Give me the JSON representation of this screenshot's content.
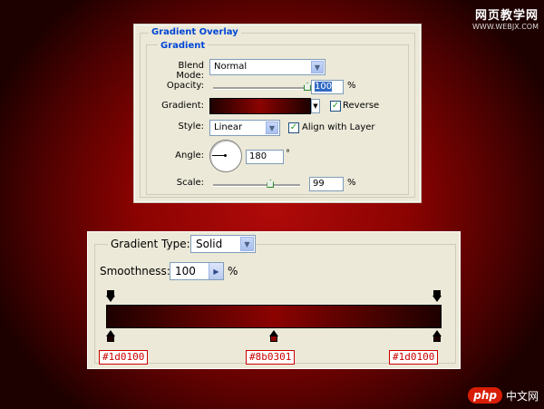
{
  "watermark_top": {
    "cn": "网页教学网",
    "url": "WWW.WEBJX.COM"
  },
  "watermark_bottom": {
    "logo": "php",
    "cn": "中文网"
  },
  "gradient_overlay": {
    "title": "Gradient Overlay",
    "section": "Gradient",
    "blend_mode_label": "Blend Mode:",
    "blend_mode_value": "Normal",
    "opacity_label": "Opacity:",
    "opacity_value": "100",
    "opacity_unit": "%",
    "gradient_label": "Gradient:",
    "reverse_label": "Reverse",
    "reverse_checked": true,
    "style_label": "Style:",
    "style_value": "Linear",
    "align_label": "Align with Layer",
    "align_checked": true,
    "angle_label": "Angle:",
    "angle_value": "180",
    "angle_unit": "°",
    "scale_label": "Scale:",
    "scale_value": "99",
    "scale_unit": "%",
    "opacity_fraction": 1.0,
    "scale_fraction": 0.66
  },
  "gradient_editor": {
    "type_label": "Gradient Type:",
    "type_value": "Solid",
    "smoothness_label": "Smoothness:",
    "smoothness_value": "100",
    "smoothness_unit": "%",
    "color_stops": [
      {
        "hex": "#1d0100",
        "label": "#1d0100",
        "location": 0
      },
      {
        "hex": "#8b0301",
        "label": "#8b0301",
        "location": 50
      },
      {
        "hex": "#1d0100",
        "label": "#1d0100",
        "location": 100
      }
    ],
    "opacity_stops": [
      {
        "location": 0
      },
      {
        "location": 100
      }
    ]
  },
  "colors": {
    "legend_blue": "#0046d5",
    "stop_label_red": "#cc0000",
    "dark": "#1d0100",
    "mid": "#8b0301"
  }
}
